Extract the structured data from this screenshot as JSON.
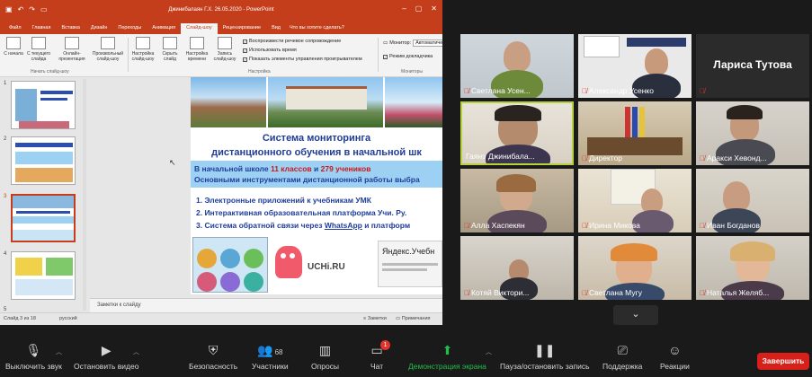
{
  "ppt": {
    "window_title": "Джинибалаян Г.Х. 26.05.2020 - PowerPoint",
    "tabs": [
      "Файл",
      "Главная",
      "Вставка",
      "Дизайн",
      "Переходы",
      "Анимация",
      "Слайд-шоу",
      "Рецензирование",
      "Вид"
    ],
    "active_tab": "Слайд-шоу",
    "search": "Что вы хотите сделать?",
    "ribbon": {
      "from_start": "С начала",
      "from_current": "С текущего слайда",
      "online": "Онлайн-презентация",
      "custom": "Произвольный слайд-шоу",
      "setup": "Настройка слайд-шоу",
      "hide": "Скрыть слайд",
      "timings": "Настройка времени",
      "record": "Запись слайд-шоу",
      "group_start": "Начать слайд-шоу",
      "group_setup": "Настройка",
      "group_monitors": "Мониторы",
      "chk_narration": "Воспроизвести речевое сопровождение",
      "chk_timings": "Использовать время",
      "chk_controls": "Показать элементы управления проигрывателем",
      "monitor_label": "Монитор:",
      "monitor_value": "Автоматически",
      "presenter_view": "Режим докладчика"
    },
    "slide_numbers": [
      "1",
      "2",
      "3",
      "4",
      "5"
    ],
    "slide": {
      "title_line1": "Система мониторинга",
      "title_line2": "дистанционного обучения в начальной шк",
      "band_prefix": "В начальной школе ",
      "band_classes": "11 классов",
      "band_and": " и ",
      "band_students": "279 учеников",
      "band_line2": "Основными инструментами дистанционной работы выбра",
      "item1": "1.  Электронные приложений к учебникам УМК",
      "item2": "2.  Интерактивная образовательная платформа Учи. Ру.",
      "item3_pre": "3.  Система обратной связи  через ",
      "item3_link": "WhatsApp",
      "item3_post": " и платформ",
      "uchi": "UCHi.RU",
      "yandex": "Яндекс.Учебн"
    },
    "notes": "Заметки к слайду",
    "status_slide": "Слайд 3 из 18",
    "status_lang": "русский",
    "status_notes": "Заметки",
    "status_comments": "Примечания"
  },
  "participants": [
    {
      "name": "Светлана Усен..."
    },
    {
      "name": "Александр Усенко"
    },
    {
      "name": "Лариса Тутова"
    },
    {
      "name": "Гаянэ Джинибала..."
    },
    {
      "name": "Директор"
    },
    {
      "name": "Аракси Хевонд..."
    },
    {
      "name": "Алла Хаспекян"
    },
    {
      "name": "Ирина Микова"
    },
    {
      "name": "Иван Богданов"
    },
    {
      "name": "Котяй Виктори..."
    },
    {
      "name": "Светлана Мугу"
    },
    {
      "name": "Наталья Желяб..."
    }
  ],
  "toolbar": {
    "mute": "Выключить звук",
    "video": "Остановить видео",
    "security": "Безопасность",
    "participants": "Участники",
    "participants_count": "68",
    "polls": "Опросы",
    "chat": "Чат",
    "chat_badge": "1",
    "share": "Демонстрация экрана",
    "pause": "Пауза/остановить запись",
    "support": "Поддержка",
    "reactions": "Реакции",
    "end": "Завершить"
  },
  "colors": {
    "ppt_accent": "#c43e1c",
    "active_speaker": "#b7d23a",
    "share_green": "#1fbf4a",
    "end_red": "#d8201a",
    "muted_mic": "#e0342c"
  }
}
